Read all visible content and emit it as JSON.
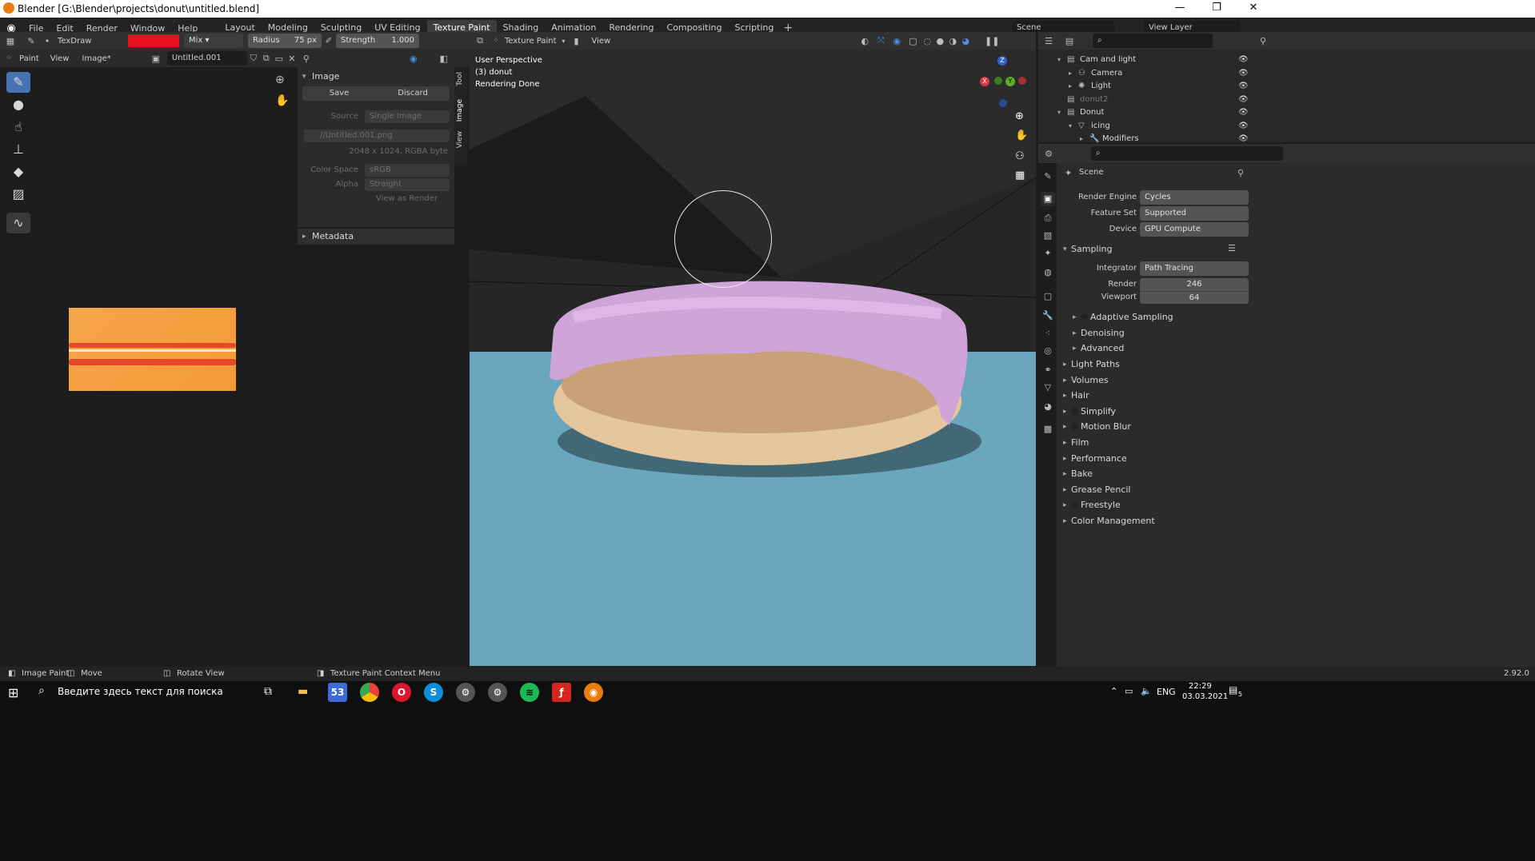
{
  "window": {
    "title": "Blender [G:\\Blender\\projects\\donut\\untitled.blend]"
  },
  "menu": [
    "File",
    "Edit",
    "Render",
    "Window",
    "Help"
  ],
  "workspaces": [
    "Layout",
    "Modeling",
    "Sculpting",
    "UV Editing",
    "Texture Paint",
    "Shading",
    "Animation",
    "Rendering",
    "Compositing",
    "Scripting"
  ],
  "active_workspace": "Texture Paint",
  "top_right": {
    "scene": "Scene",
    "view_layer": "View Layer"
  },
  "tool_header": {
    "brush_name": "TexDraw",
    "brush_color": "#e8101c",
    "blend": "Mix",
    "radius_label": "Radius",
    "radius_value": "75 px",
    "strength_label": "Strength",
    "strength_value": "1.000"
  },
  "image_header": {
    "mode": "Paint",
    "view": "View",
    "image_menu": "Image*",
    "image_name": "Untitled.001"
  },
  "image_panel": {
    "title": "Image",
    "save": "Save",
    "discard": "Discard",
    "source_label": "Source",
    "source_value": "Single Image",
    "filepath": "//Untitled.001.png",
    "info": "2048 x 1024,  RGBA byte",
    "color_space_label": "Color Space",
    "color_space_value": "sRGB",
    "alpha_label": "Alpha",
    "alpha_value": "Straight",
    "view_as_render": "View as Render",
    "metadata": "Metadata",
    "side_tabs": [
      "Tool",
      "Image",
      "View"
    ]
  },
  "viewport_header": {
    "mode": "Texture Paint",
    "view": "View"
  },
  "viewport_overlay": {
    "perspective": "User Perspective",
    "object": "(3) donut",
    "status": "Rendering Done"
  },
  "outliner": {
    "rows": [
      {
        "label": "Cam and light",
        "indent": 1
      },
      {
        "label": "Camera",
        "indent": 2
      },
      {
        "label": "Light",
        "indent": 2
      },
      {
        "label": "donut2",
        "indent": 1
      },
      {
        "label": "Donut",
        "indent": 1
      },
      {
        "label": "icing",
        "indent": 2
      },
      {
        "label": "Modifiers",
        "indent": 3
      }
    ]
  },
  "properties": {
    "scene_label": "Scene",
    "render_engine_label": "Render Engine",
    "render_engine": "Cycles",
    "feature_set_label": "Feature Set",
    "feature_set": "Supported",
    "device_label": "Device",
    "device": "GPU Compute",
    "sampling": "Sampling",
    "integrator_label": "Integrator",
    "integrator": "Path Tracing",
    "render_label": "Render",
    "render_samples": "246",
    "viewport_label": "Viewport",
    "viewport_samples": "64",
    "sub_sections": [
      "Adaptive Sampling",
      "Denoising",
      "Advanced"
    ],
    "sections": [
      "Light Paths",
      "Volumes",
      "Hair",
      "Simplify",
      "Motion Blur",
      "Film",
      "Performance",
      "Bake",
      "Grease Pencil",
      "Freestyle",
      "Color Management"
    ]
  },
  "statusbar": {
    "image_paint": "Image Paint",
    "move": "Move",
    "rotate": "Rotate View",
    "context": "Texture Paint Context Menu",
    "version": "2.92.0"
  },
  "taskbar": {
    "search_placeholder": "Введите здесь текст для поиска",
    "lang": "ENG",
    "time": "22:29",
    "date": "03.03.2021",
    "notif": "5"
  }
}
